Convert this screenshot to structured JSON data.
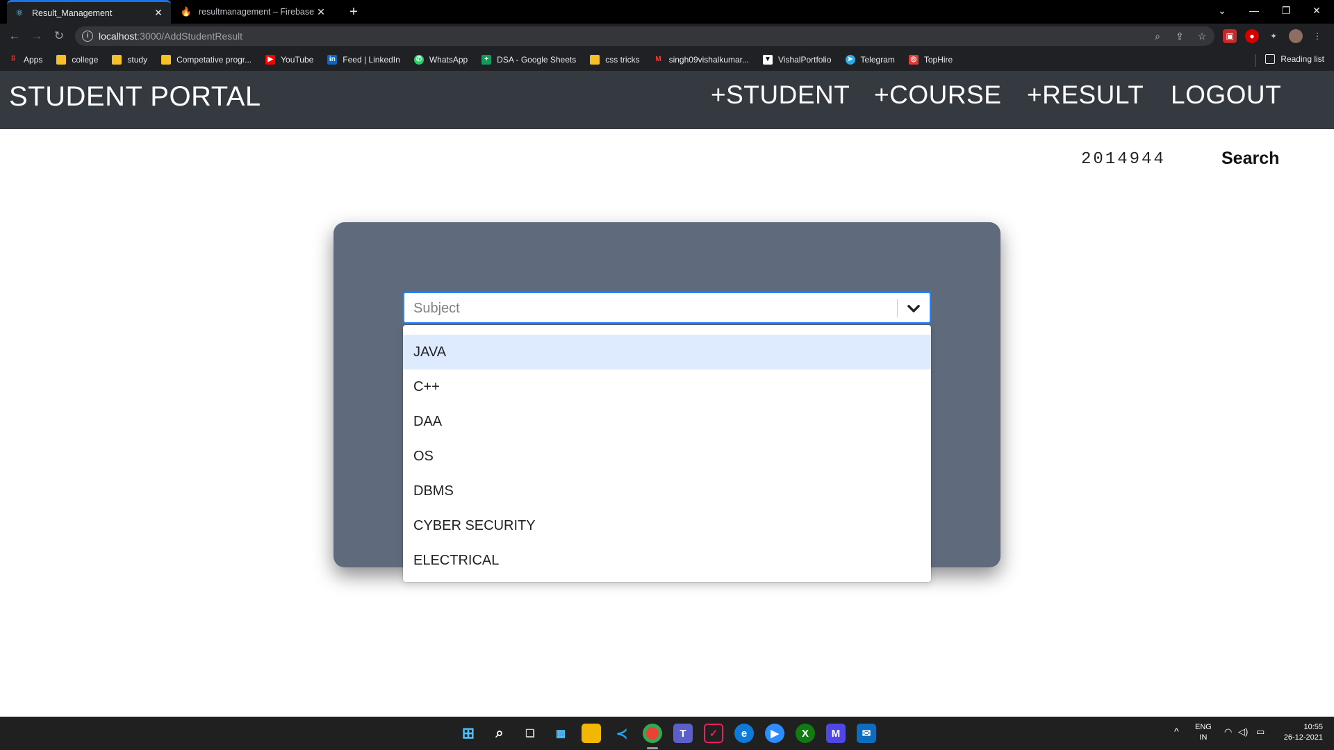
{
  "browser": {
    "tabs": [
      {
        "title": "Result_Management",
        "active": true
      },
      {
        "title": "resultmanagement – Firebase co",
        "active": false
      }
    ],
    "url_host": "localhost",
    "url_path": ":3000/AddStudentResult",
    "bookmarks": [
      "Apps",
      "college",
      "study",
      "Competative progr...",
      "YouTube",
      "Feed | LinkedIn",
      "WhatsApp",
      "DSA - Google Sheets",
      "css tricks",
      "singh09vishalkumar...",
      "VishalPortfolio",
      "Telegram",
      "TopHire"
    ],
    "reading_list": "Reading list"
  },
  "app": {
    "brand": "STUDENT PORTAL",
    "nav": {
      "student": "+STUDENT",
      "course": "+COURSE",
      "result": "+RESULT",
      "logout": "LOGOUT"
    },
    "search": {
      "value": "2014944",
      "button": "Search"
    },
    "subject_select": {
      "placeholder": "Subject",
      "options": [
        "JAVA",
        "C++",
        "DAA",
        "OS",
        "DBMS",
        "CYBER SECURITY",
        "ELECTRICAL"
      ],
      "focused_option": "JAVA"
    }
  },
  "taskbar": {
    "lang_line1": "ENG",
    "lang_line2": "IN",
    "time": "10:55",
    "date": "26-12-2021"
  },
  "colors": {
    "navbar": "#343a40",
    "card": "#5f6b7d",
    "select_border": "#2684ff",
    "option_focus": "#deebff"
  }
}
